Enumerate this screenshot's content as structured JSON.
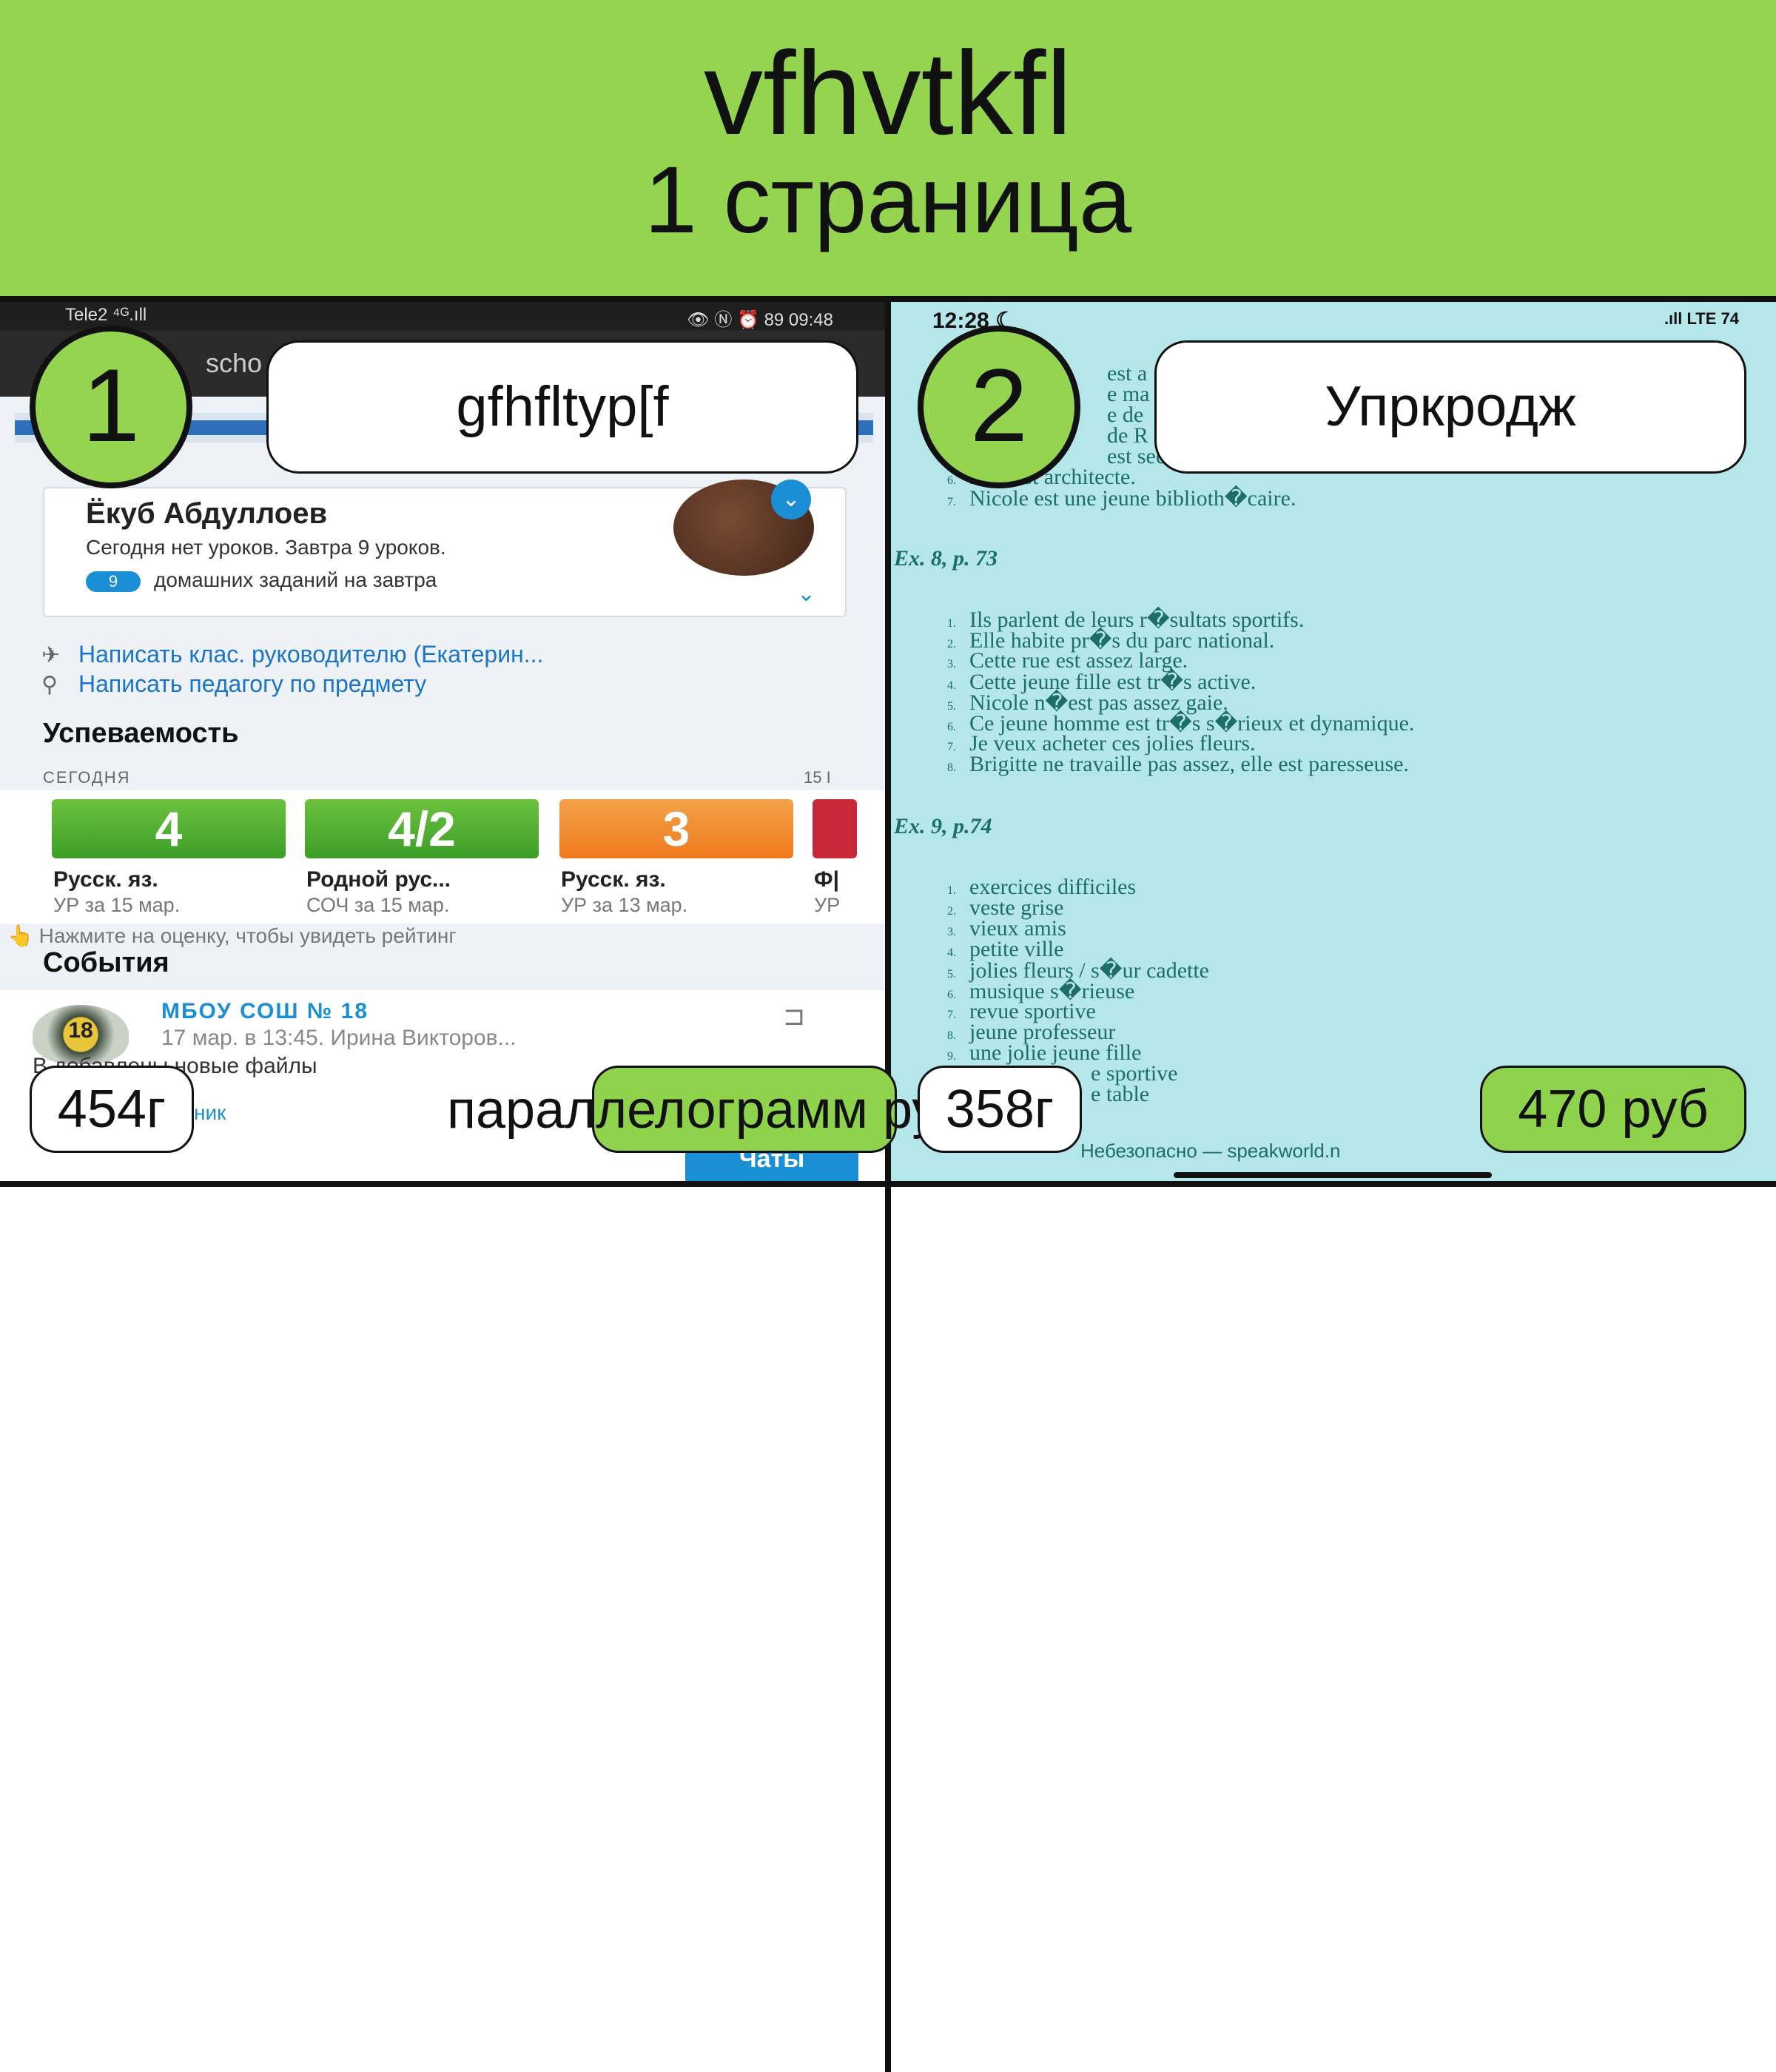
{
  "header": {
    "title": "vfhvtkfl",
    "subtitle": "1 страница"
  },
  "panel1": {
    "number": "1",
    "label": "gfhfltyp[f",
    "price_tag": "454г",
    "overlay_text": "параллелограмм руб",
    "phone": {
      "carrier": "Tele2 ⁴ᴳ.ıll",
      "status_right": "👁 Ⓝ ⏰ 89 09:48",
      "app_title": "scho",
      "profile_name": "Ёкуб Абдуллоев",
      "profile_sub": "Сегодня нет уроков. Завтра 9 уроков.",
      "homework_count": "9",
      "homework_text": "домашних заданий на завтра",
      "link1": "Написать клас. руководителю (Екатерин...",
      "link2": "Написать педагогу по предмету",
      "grades_title": "Успеваемость",
      "today_label": "СЕГОДНЯ",
      "today_right": "15 I",
      "grades": [
        {
          "value": "4",
          "subject": "Русск. яз.",
          "sub": "УР за 15 мар."
        },
        {
          "value": "4/2",
          "subject": "Родной рус...",
          "sub": "СОЧ за 15 мар."
        },
        {
          "value": "3",
          "subject": "Русск. яз.",
          "sub": "УР за 13 мар."
        },
        {
          "value": "",
          "subject": "Ф|",
          "sub": "УР"
        }
      ],
      "hint": "👆 Нажмите на оценку, чтобы увидеть рейтинг",
      "events_title": "События",
      "event_logo": "18",
      "event_org": "МБОУ СОШ № 18",
      "event_meta": "17 мар. в 13:45. Ирина Викторов...",
      "event_body": "В        добавлены новые файлы",
      "event_more": "ник",
      "chats_button": "Чаты"
    }
  },
  "panel2": {
    "number": "2",
    "label": "Упркродж",
    "price_tag": "358г",
    "price_button": "470 руб",
    "phone": {
      "time": "12:28 ☾",
      "status_right": ".ıll LTE 74",
      "lines_top": [
        {
          "n": "",
          "t": "est a"
        },
        {
          "n": "",
          "t": "e ma"
        },
        {
          "n": "",
          "t": "e de"
        },
        {
          "n": "",
          "t": "de R"
        },
        {
          "n": "",
          "t": "est sec"
        },
        {
          "n": "6.",
          "t": "N      re est architecte."
        },
        {
          "n": "7.",
          "t": "Nicole est une jeune biblioth�caire."
        }
      ],
      "ex8": "Ex. 8, p. 73",
      "ex8_lines": [
        {
          "n": "1.",
          "t": "Ils parlent de leurs r�sultats sportifs."
        },
        {
          "n": "2.",
          "t": "Elle habite pr�s du parc national."
        },
        {
          "n": "3.",
          "t": "Cette rue est assez large."
        },
        {
          "n": "4.",
          "t": "Cette jeune fille est tr�s active."
        },
        {
          "n": "5.",
          "t": "Nicole n�est pas assez gaie."
        },
        {
          "n": "6.",
          "t": "Ce jeune homme est tr�s s�rieux et dynamique."
        },
        {
          "n": "7.",
          "t": "Je veux acheter ces jolies fleurs."
        },
        {
          "n": "8.",
          "t": "Brigitte ne travaille pas assez, elle est paresseuse."
        }
      ],
      "ex9": "Ex. 9, p.74",
      "ex9_lines": [
        {
          "n": "1.",
          "t": "exercices difficiles"
        },
        {
          "n": "2.",
          "t": "veste grise"
        },
        {
          "n": "3.",
          "t": "vieux amis"
        },
        {
          "n": "4.",
          "t": "petite ville"
        },
        {
          "n": "5.",
          "t": "jolies fleurs / s�ur cadette"
        },
        {
          "n": "6.",
          "t": "musique s�rieuse"
        },
        {
          "n": "7.",
          "t": "revue sportive"
        },
        {
          "n": "8.",
          "t": "jeune professeur"
        },
        {
          "n": "9.",
          "t": "une jolie jeune fille"
        },
        {
          "n": "",
          "t": "e sportive"
        },
        {
          "n": "",
          "t": "e table"
        }
      ],
      "url": "Небезопасно — speakworld.n"
    }
  },
  "colors": {
    "header_green": "#95d44f",
    "price_green": "#8fd34c",
    "phone2_bg": "#b4e6ea",
    "link_blue": "#1a74c8"
  }
}
